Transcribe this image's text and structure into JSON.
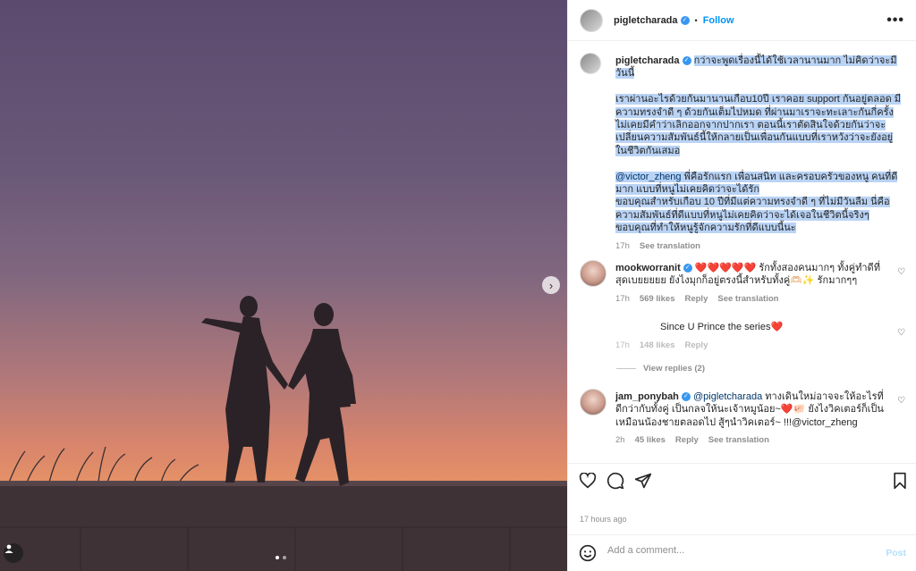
{
  "post": {
    "username": "pigletcharada",
    "follow_label": "Follow",
    "dot_separator": "•",
    "more_label": "•••"
  },
  "photo": {
    "next_label": "›",
    "slide_count": 2,
    "active_slide": 1
  },
  "caption": {
    "username": "pigletcharada",
    "para1": "กว่าจะพูดเรื่องนี้ได้ใช้เวลานานมาก ไม่คิดว่าจะมีวันนี้",
    "para2": "เราผ่านอะไรด้วยกันมานานเกือบ10ปี เราคอย support กันอยู่ตลอด มีความทรงจำดี ๆ ด้วยกันเต็มไปหมด ที่ผ่านมาเราจะทะเลาะกันกี่ครั้งไม่เคยมีคำว่าเลิกออกจากปากเรา ตอนนี้เราตัดสินใจด้วยกันว่าจะเปลี่ยนความสัมพันธ์นี้ให้กลายเป็นเพื่อนกันแบบที่เราหวังว่าจะยังอยู่ในชีวิตกันเสมอ",
    "mention": "@victor_zheng",
    "para3a": " พี่คือรักแรก เพื่อนสนิท และครอบครัวของหนู คนที่ดีมาก แบบที่หนูไม่เคยคิดว่าจะได้รัก",
    "para3b": "ขอบคุณสำหรับเกือบ 10 ปีที่มีแต่ความทรงจำดี ๆ ที่ไม่มีวันลืม นี่คือความสัมพันธ์ที่ดีแบบที่หนูไม่เคยคิดว่าจะได้เจอในชีวิตนี้จริงๆ",
    "para3c": "ขอบคุณที่ทำให้หนูรู้จักความรักที่ดีแบบนี้นะ",
    "time": "17h",
    "see_translation": "See translation"
  },
  "comments": [
    {
      "username": "mookworranit",
      "text": "❤️❤️❤️❤️❤️ รักทั้งสองคนมากๆ ทั้งคู่ทำดีที่สุดเบยยยยย ยังไงมุกก็อยู่ตรงนี้สำหรับทั้งคู่🫶🏻✨ รักมากๆๆ",
      "time": "17h",
      "likes": "569 likes",
      "reply": "Reply",
      "see_translation": "See translation"
    },
    {
      "text": "Since U Prince the series❤️",
      "time": "17h",
      "likes": "148 likes",
      "reply": "Reply",
      "view_replies": "View replies (2)"
    },
    {
      "username": "jam_ponybah",
      "mention": "@pigletcharada",
      "text": " ทางเดินใหม่อาจจะให้อะไรที่ดีกว่ากับทั้งคู่ เป็นกลจให้นะเจ้าหมูน้อย~❤️🐖 ยังไงวิคเตอร์ก็เป็นเหมือนน้องชายตลอดไป สู้ๆนำวิคเตอร์~ !!!@victor_zheng",
      "time": "2h",
      "likes": "45 likes",
      "reply": "Reply",
      "see_translation": "See translation"
    }
  ],
  "footer": {
    "timestamp": "17 hours ago",
    "comment_placeholder": "Add a comment...",
    "post_label": "Post"
  },
  "colors": {
    "link": "#0095f6",
    "verified": "#3897f0",
    "selection": "#b9d3f5",
    "muted": "#8e8e8e"
  }
}
